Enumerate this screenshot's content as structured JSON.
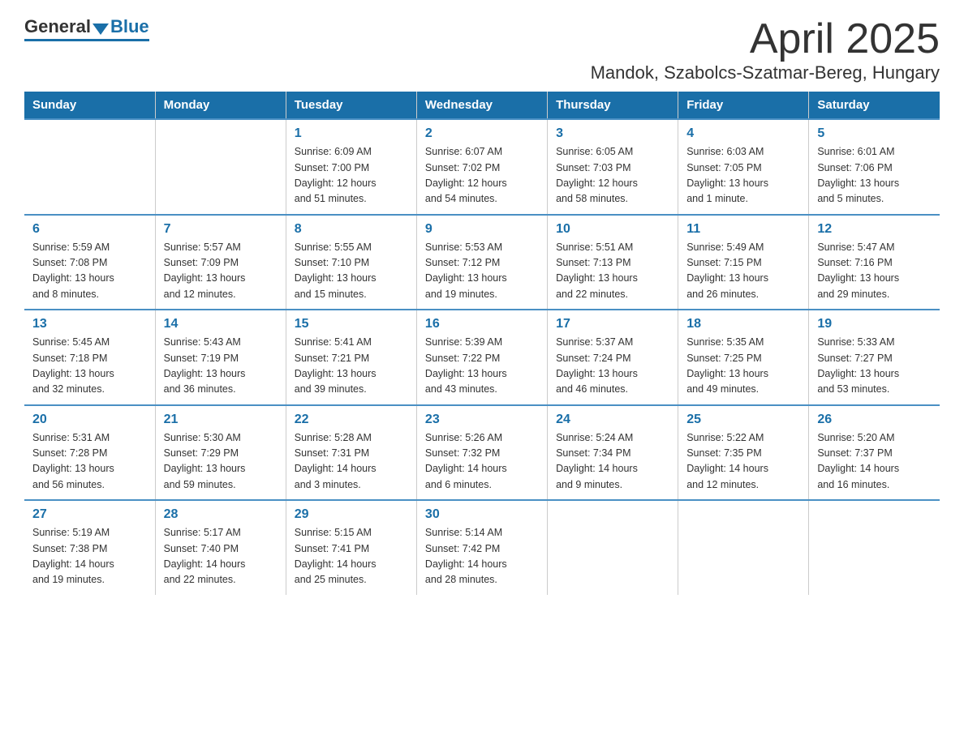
{
  "header": {
    "logo_general": "General",
    "logo_blue": "Blue",
    "month_title": "April 2025",
    "location": "Mandok, Szabolcs-Szatmar-Bereg, Hungary"
  },
  "days_of_week": [
    "Sunday",
    "Monday",
    "Tuesday",
    "Wednesday",
    "Thursday",
    "Friday",
    "Saturday"
  ],
  "weeks": [
    [
      {
        "day": "",
        "info": ""
      },
      {
        "day": "",
        "info": ""
      },
      {
        "day": "1",
        "info": "Sunrise: 6:09 AM\nSunset: 7:00 PM\nDaylight: 12 hours\nand 51 minutes."
      },
      {
        "day": "2",
        "info": "Sunrise: 6:07 AM\nSunset: 7:02 PM\nDaylight: 12 hours\nand 54 minutes."
      },
      {
        "day": "3",
        "info": "Sunrise: 6:05 AM\nSunset: 7:03 PM\nDaylight: 12 hours\nand 58 minutes."
      },
      {
        "day": "4",
        "info": "Sunrise: 6:03 AM\nSunset: 7:05 PM\nDaylight: 13 hours\nand 1 minute."
      },
      {
        "day": "5",
        "info": "Sunrise: 6:01 AM\nSunset: 7:06 PM\nDaylight: 13 hours\nand 5 minutes."
      }
    ],
    [
      {
        "day": "6",
        "info": "Sunrise: 5:59 AM\nSunset: 7:08 PM\nDaylight: 13 hours\nand 8 minutes."
      },
      {
        "day": "7",
        "info": "Sunrise: 5:57 AM\nSunset: 7:09 PM\nDaylight: 13 hours\nand 12 minutes."
      },
      {
        "day": "8",
        "info": "Sunrise: 5:55 AM\nSunset: 7:10 PM\nDaylight: 13 hours\nand 15 minutes."
      },
      {
        "day": "9",
        "info": "Sunrise: 5:53 AM\nSunset: 7:12 PM\nDaylight: 13 hours\nand 19 minutes."
      },
      {
        "day": "10",
        "info": "Sunrise: 5:51 AM\nSunset: 7:13 PM\nDaylight: 13 hours\nand 22 minutes."
      },
      {
        "day": "11",
        "info": "Sunrise: 5:49 AM\nSunset: 7:15 PM\nDaylight: 13 hours\nand 26 minutes."
      },
      {
        "day": "12",
        "info": "Sunrise: 5:47 AM\nSunset: 7:16 PM\nDaylight: 13 hours\nand 29 minutes."
      }
    ],
    [
      {
        "day": "13",
        "info": "Sunrise: 5:45 AM\nSunset: 7:18 PM\nDaylight: 13 hours\nand 32 minutes."
      },
      {
        "day": "14",
        "info": "Sunrise: 5:43 AM\nSunset: 7:19 PM\nDaylight: 13 hours\nand 36 minutes."
      },
      {
        "day": "15",
        "info": "Sunrise: 5:41 AM\nSunset: 7:21 PM\nDaylight: 13 hours\nand 39 minutes."
      },
      {
        "day": "16",
        "info": "Sunrise: 5:39 AM\nSunset: 7:22 PM\nDaylight: 13 hours\nand 43 minutes."
      },
      {
        "day": "17",
        "info": "Sunrise: 5:37 AM\nSunset: 7:24 PM\nDaylight: 13 hours\nand 46 minutes."
      },
      {
        "day": "18",
        "info": "Sunrise: 5:35 AM\nSunset: 7:25 PM\nDaylight: 13 hours\nand 49 minutes."
      },
      {
        "day": "19",
        "info": "Sunrise: 5:33 AM\nSunset: 7:27 PM\nDaylight: 13 hours\nand 53 minutes."
      }
    ],
    [
      {
        "day": "20",
        "info": "Sunrise: 5:31 AM\nSunset: 7:28 PM\nDaylight: 13 hours\nand 56 minutes."
      },
      {
        "day": "21",
        "info": "Sunrise: 5:30 AM\nSunset: 7:29 PM\nDaylight: 13 hours\nand 59 minutes."
      },
      {
        "day": "22",
        "info": "Sunrise: 5:28 AM\nSunset: 7:31 PM\nDaylight: 14 hours\nand 3 minutes."
      },
      {
        "day": "23",
        "info": "Sunrise: 5:26 AM\nSunset: 7:32 PM\nDaylight: 14 hours\nand 6 minutes."
      },
      {
        "day": "24",
        "info": "Sunrise: 5:24 AM\nSunset: 7:34 PM\nDaylight: 14 hours\nand 9 minutes."
      },
      {
        "day": "25",
        "info": "Sunrise: 5:22 AM\nSunset: 7:35 PM\nDaylight: 14 hours\nand 12 minutes."
      },
      {
        "day": "26",
        "info": "Sunrise: 5:20 AM\nSunset: 7:37 PM\nDaylight: 14 hours\nand 16 minutes."
      }
    ],
    [
      {
        "day": "27",
        "info": "Sunrise: 5:19 AM\nSunset: 7:38 PM\nDaylight: 14 hours\nand 19 minutes."
      },
      {
        "day": "28",
        "info": "Sunrise: 5:17 AM\nSunset: 7:40 PM\nDaylight: 14 hours\nand 22 minutes."
      },
      {
        "day": "29",
        "info": "Sunrise: 5:15 AM\nSunset: 7:41 PM\nDaylight: 14 hours\nand 25 minutes."
      },
      {
        "day": "30",
        "info": "Sunrise: 5:14 AM\nSunset: 7:42 PM\nDaylight: 14 hours\nand 28 minutes."
      },
      {
        "day": "",
        "info": ""
      },
      {
        "day": "",
        "info": ""
      },
      {
        "day": "",
        "info": ""
      }
    ]
  ],
  "colors": {
    "header_bg": "#1a6fa8",
    "header_text": "#ffffff",
    "border_top": "#4a90c4",
    "day_number": "#1a6fa8"
  }
}
